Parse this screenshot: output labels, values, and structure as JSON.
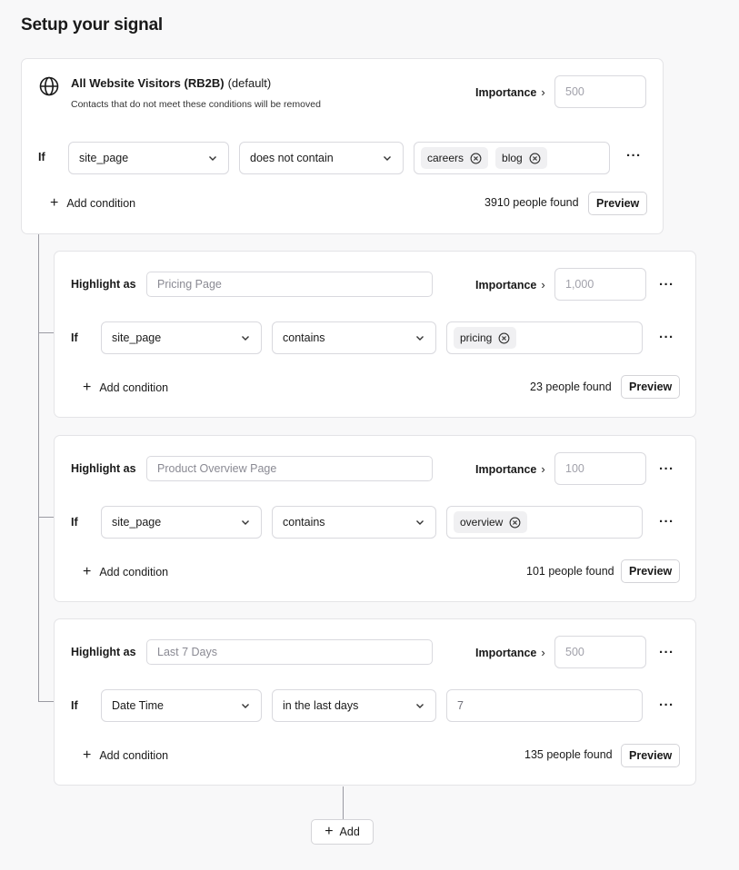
{
  "page": {
    "title": "Setup your signal"
  },
  "base": {
    "title": "All Website Visitors (RB2B)",
    "default_label": "(default)",
    "subtitle": "Contacts that do not meet these conditions will be removed",
    "importance_label": "Importance",
    "importance_placeholder": "500",
    "if_label": "If",
    "field": "site_page",
    "operator": "does not contain",
    "tags": [
      "careers",
      "blog"
    ],
    "add_condition": "Add condition",
    "found": "3910 people found",
    "preview": "Preview"
  },
  "highlights": [
    {
      "label": "Highlight as",
      "name_placeholder": "Pricing Page",
      "importance_label": "Importance",
      "importance_placeholder": "1,000",
      "if_label": "If",
      "field": "site_page",
      "operator": "contains",
      "tags": [
        "pricing"
      ],
      "add_condition": "Add condition",
      "found": "23 people found",
      "preview": "Preview"
    },
    {
      "label": "Highlight as",
      "name_placeholder": "Product Overview Page",
      "importance_label": "Importance",
      "importance_placeholder": "100",
      "if_label": "If",
      "field": "site_page",
      "operator": "contains",
      "tags": [
        "overview"
      ],
      "add_condition": "Add condition",
      "found": "101 people found",
      "preview": "Preview"
    },
    {
      "label": "Highlight as",
      "name_placeholder": "Last 7 Days",
      "importance_label": "Importance",
      "importance_placeholder": "500",
      "if_label": "If",
      "field": "Date Time",
      "operator": "in the last days",
      "value_placeholder": "7",
      "add_condition": "Add condition",
      "found": "135 people found",
      "preview": "Preview"
    }
  ],
  "footer": {
    "add_label": "Add"
  },
  "icons": {
    "globe": "globe-icon",
    "chevron": "chevron-down-icon",
    "tag_remove": "circle-x-icon",
    "more": "more-horizontal-icon",
    "plus": "plus-icon"
  }
}
